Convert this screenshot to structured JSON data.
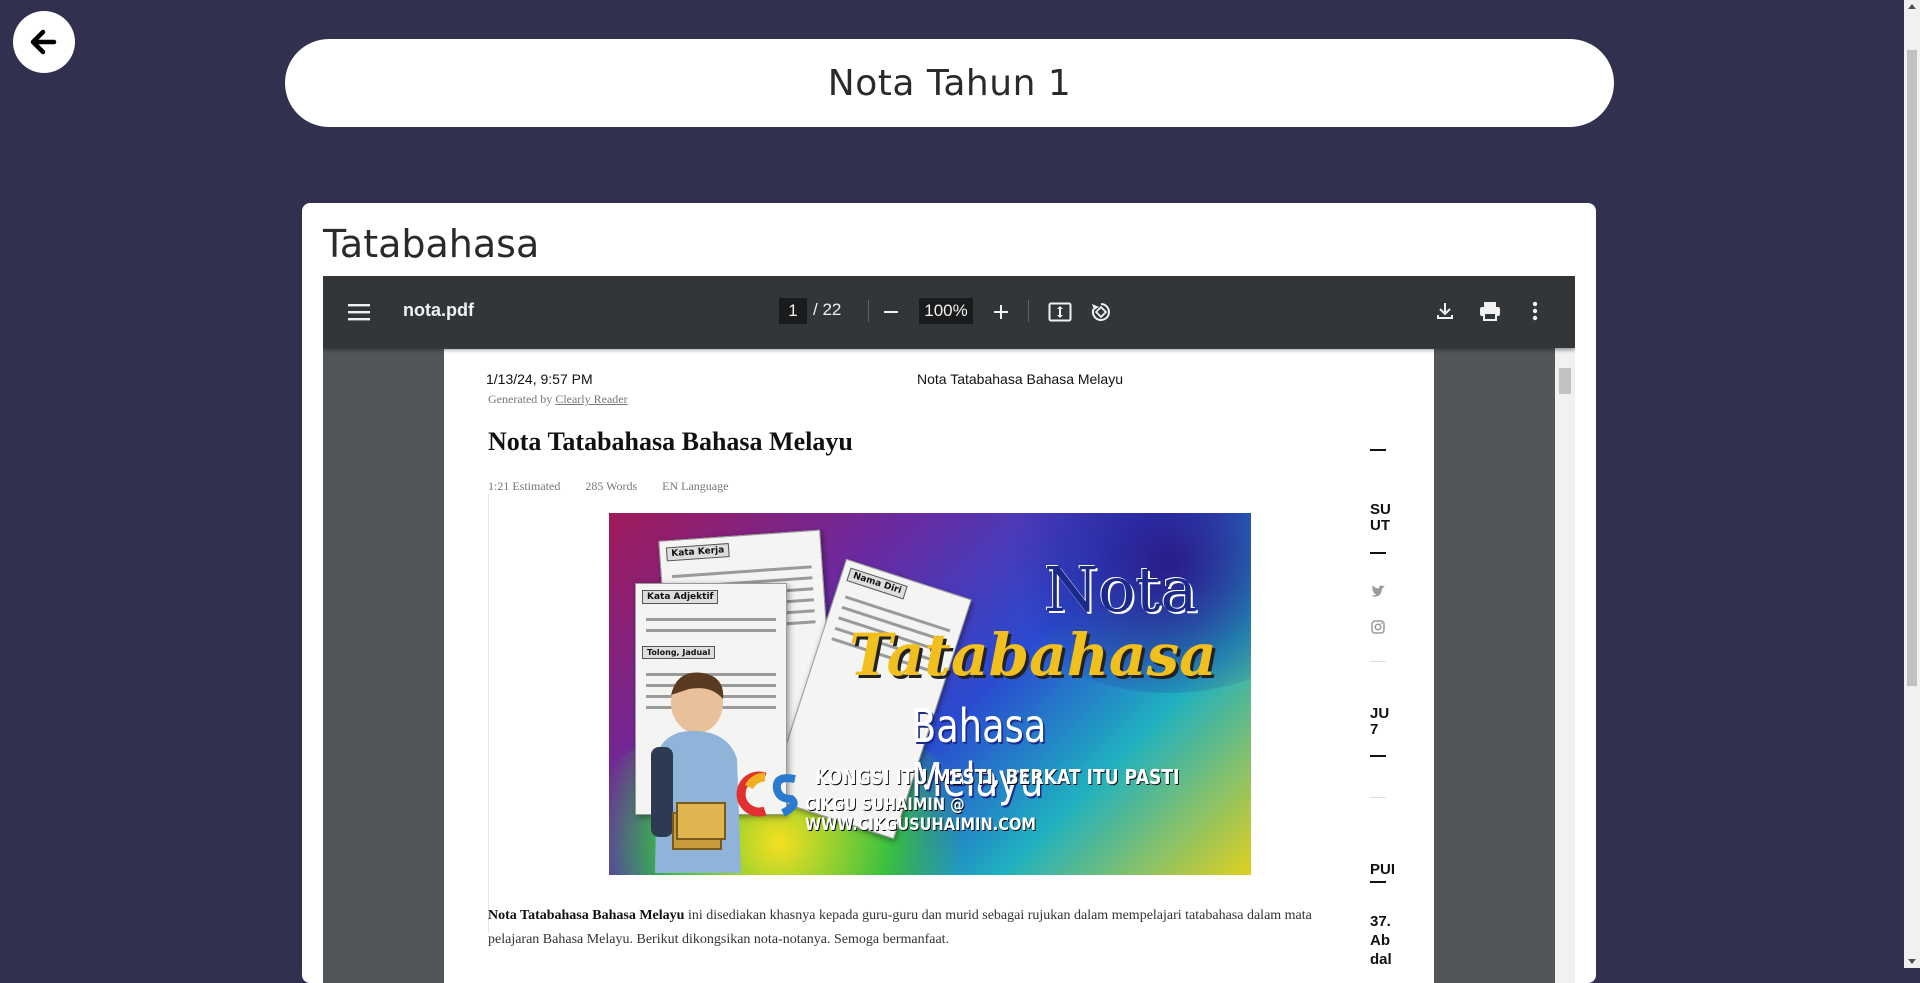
{
  "header": {
    "title": "Nota Tahun 1"
  },
  "nav": {
    "back_icon": "arrow-left-icon"
  },
  "card": {
    "title": "Tatabahasa"
  },
  "pdf_viewer": {
    "filename": "nota.pdf",
    "current_page": "1",
    "total_pages": "/ 22",
    "zoom": "100%",
    "icons": [
      "menu-icon",
      "zoom-out-icon",
      "zoom-in-icon",
      "fit-page-icon",
      "rotate-icon",
      "download-icon",
      "print-icon",
      "more-options-icon"
    ]
  },
  "pdf_page": {
    "header_date": "1/13/24, 9:57 PM",
    "header_title": "Nota Tatabahasa Bahasa Melayu",
    "generated_by_prefix": "Generated by",
    "generated_by_link": "Clearly Reader",
    "title": "Nota Tatabahasa Bahasa Melayu",
    "meta": {
      "time": "1:21 Estimated",
      "words": "285 Words",
      "language": "EN Language"
    },
    "banner": {
      "nota": "Nota",
      "tatabahasa": "Tatabahasa",
      "bahasa_melayu": "Bahasa Melayu",
      "tagline": "KONGSI ITU MESTI, BERKAT ITU PASTI",
      "credit": "CIKGU SUHAIMIN @ WWW.CIKGUSUHAIMIN.COM",
      "sheet_labels": [
        "Kata Kerja",
        "Kata Adjektif",
        "Nama Diri",
        "Tolong, Jadual"
      ]
    },
    "body_bold": "Nota Tatabahasa Bahasa Melayu",
    "body_text": " ini disediakan khasnya kepada guru-guru dan murid sebagai rujukan dalam mempelajari tatabahasa dalam mata pelajaran Bahasa Melayu. Berikut dikongsikan nota-notanya. Semoga bermanfaat.",
    "side_fragments": [
      "SU",
      "UT",
      "JU",
      "7",
      "PUI",
      "37.",
      "Ab",
      "dal"
    ]
  },
  "colors": {
    "background": "#32304f",
    "toolbar": "#323639",
    "viewer_bg": "#525659"
  }
}
